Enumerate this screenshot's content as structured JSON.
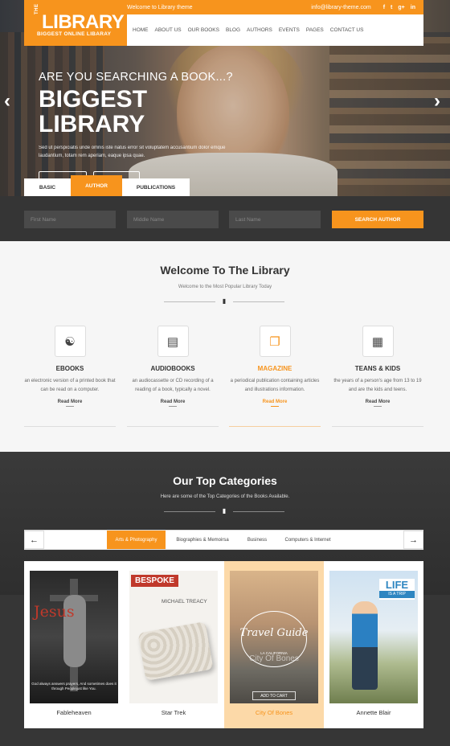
{
  "topbar": {
    "welcome": "Welcome to Library theme",
    "email": "info@library-theme.com",
    "social": [
      "f",
      "t",
      "g+",
      "in"
    ]
  },
  "logo": {
    "the": "THE",
    "name": "LIBRARY",
    "tagline": "BIGGEST ONLINE LIBARAY"
  },
  "nav": [
    "HOME",
    "ABOUT US",
    "OUR BOOKS",
    "BLOG",
    "AUTHORS",
    "EVENTS",
    "PAGES",
    "CONTACT US"
  ],
  "hero": {
    "small": "ARE YOU SEARCHING A BOOK...?",
    "big": "BIGGEST LIBRARY",
    "desc": "Sed ut perspiciatis unde omnis iste natus error sit voluptatem accusantium dolor emque laudantium, totam rem aperiam, eaque ipsa quae.",
    "prev_icon": "chevron-left-icon",
    "next_icon": "chevron-right-icon"
  },
  "search_tabs": [
    {
      "label": "BASIC",
      "active": false
    },
    {
      "label": "AUTHOR",
      "active": true
    },
    {
      "label": "PUBLICATIONS",
      "active": false
    }
  ],
  "search": {
    "first": "First Name",
    "middle": "Middle Name",
    "last": "Last Name",
    "button": "SEARCH AUTHOR"
  },
  "welcome": {
    "title": "Welcome To The Library",
    "subtitle": "Welcome to the Most Popular Library Today",
    "features": [
      {
        "icon": "gift-icon",
        "title": "EBOOKS",
        "desc": "an electronic version of a printed book that can be read on a computer.",
        "more": "Read More"
      },
      {
        "icon": "book-icon",
        "title": "AUDIOBOOKS",
        "desc": "an audiocassette or CD recording of a reading of a book, typically a novel.",
        "more": "Read More"
      },
      {
        "icon": "copy-icon",
        "title": "MAGAZINE",
        "desc": "a periodical publication containing articles and illustrations information.",
        "more": "Read More"
      },
      {
        "icon": "calculator-icon",
        "title": "TEANS & KIDS",
        "desc": "the years of a person's age from 13 to 19 and are the kids and teens.",
        "more": "Read More"
      }
    ]
  },
  "categories": {
    "title": "Our Top Categories",
    "subtitle": "Here are some of the Top Categories of the Books Available.",
    "tabs": [
      "Arts & Photography",
      "Biographies & Memoirsa",
      "Business",
      "Computers & Internet"
    ],
    "active_tab": 0,
    "books": [
      {
        "title": "Fableheaven",
        "cover_text": "Jesus",
        "cover_caption": "God always answers prayers, And sometimes does it through Peoplejust like You."
      },
      {
        "title": "Star Trek",
        "cover_badge": "BESPOKE",
        "cover_author": "MICHAEL TREACY"
      },
      {
        "title": "City Of Bones",
        "cover_text": "Travel Guide",
        "cover_loc": "LA CALIFORNIA",
        "cover_overlay": "City Of Bones",
        "cover_button": "ADD TO CART"
      },
      {
        "title": "Annette Blair",
        "cover_text": "LIFE",
        "cover_sub": "IS A TRIP"
      }
    ]
  },
  "colors": {
    "accent": "#f7941d",
    "dark": "#353535"
  }
}
